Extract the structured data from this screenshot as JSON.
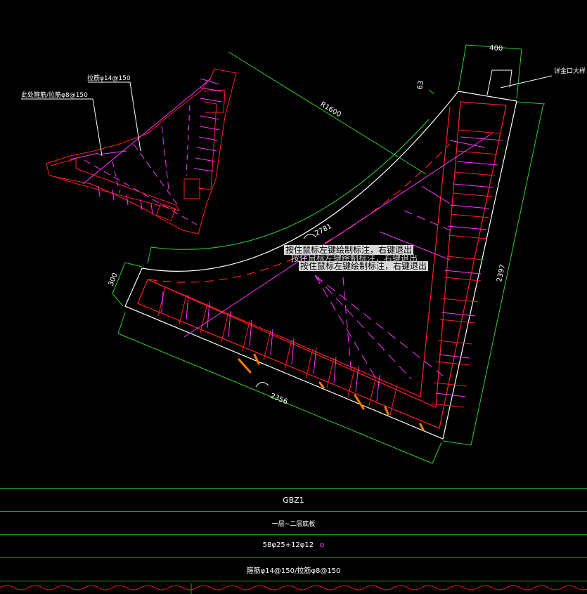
{
  "drawing": {
    "dimensions": {
      "top_width": "400",
      "right_height": "2397",
      "left_end": "300",
      "bottom_length": "2356",
      "radius": "R1600",
      "arc_length": "2781",
      "offset": "63"
    },
    "labels": {
      "column_label": "详金口大样",
      "stirrup_label": "拉筋φ14@150",
      "tie_label": "此处箍筋/拉筋φ8@150"
    },
    "tooltips": [
      "按住鼠标左键绘制标注，右键退出",
      "按住鼠标左键绘制标注，右键退出",
      "按住鼠标左键绘制标注，右键退出"
    ]
  },
  "table": {
    "name": "GBZ1",
    "level": "一层~二层底板",
    "main_rebar": "58φ25+12φ12",
    "stirrup": "箍筋φ14@150/拉筋φ8@150"
  },
  "colors": {
    "dimension": "#2ed12e",
    "outline": "#ffffff",
    "rebar": "#ff2020",
    "tie": "#ff35ff",
    "highlight": "#ff7a00",
    "tooltip_bg": "#d9d9d9"
  }
}
